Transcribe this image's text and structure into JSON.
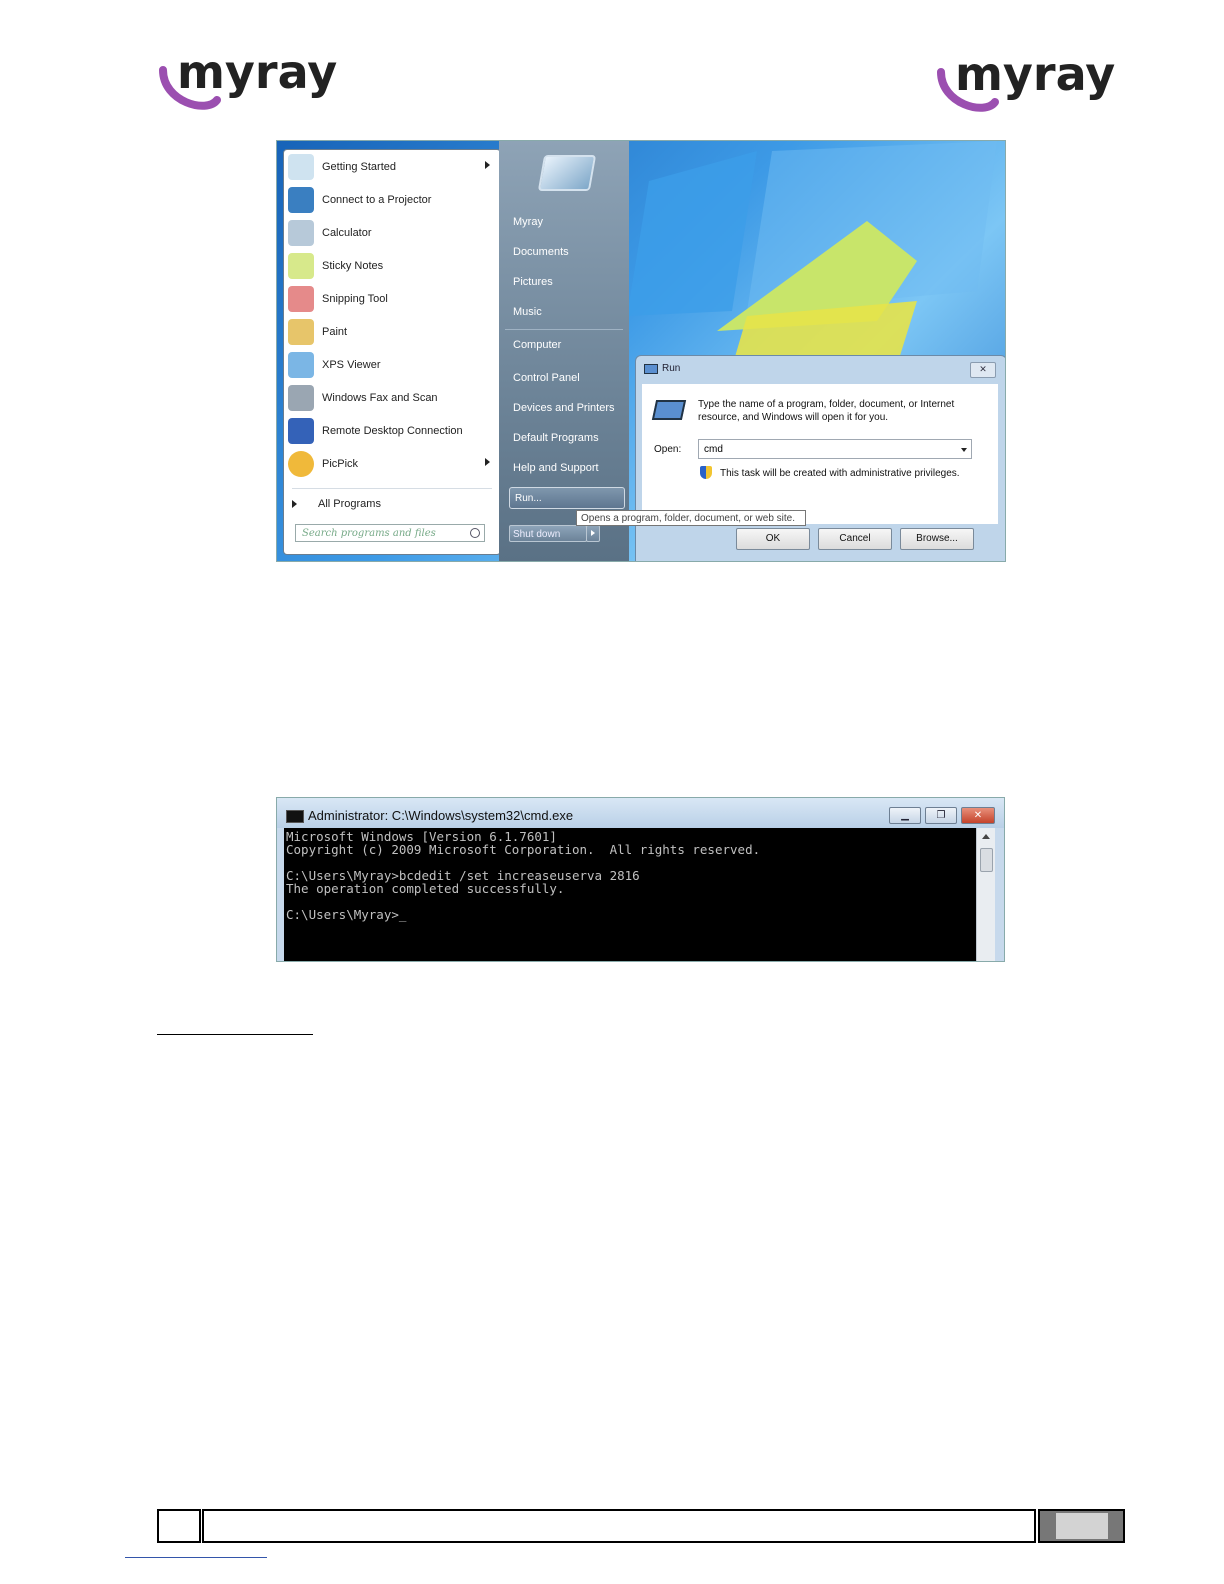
{
  "brand": {
    "logo_text": "myray",
    "accent": "#9b4fb0",
    "ink": "#222222"
  },
  "start_menu": {
    "programs": [
      {
        "label": "Getting Started",
        "icon": "getting-started-icon",
        "submenu": true
      },
      {
        "label": "Connect to a Projector",
        "icon": "projector-icon",
        "submenu": false
      },
      {
        "label": "Calculator",
        "icon": "calculator-icon",
        "submenu": false
      },
      {
        "label": "Sticky Notes",
        "icon": "sticky-notes-icon",
        "submenu": false
      },
      {
        "label": "Snipping Tool",
        "icon": "snipping-tool-icon",
        "submenu": false
      },
      {
        "label": "Paint",
        "icon": "paint-icon",
        "submenu": false
      },
      {
        "label": "XPS Viewer",
        "icon": "xps-viewer-icon",
        "submenu": false
      },
      {
        "label": "Windows Fax and Scan",
        "icon": "fax-scan-icon",
        "submenu": false
      },
      {
        "label": "Remote Desktop Connection",
        "icon": "remote-desktop-icon",
        "submenu": false
      },
      {
        "label": "PicPick",
        "icon": "picpick-icon",
        "submenu": true
      }
    ],
    "all_programs": "All Programs",
    "search_placeholder": "Search programs and files",
    "right_items": [
      "Myray",
      "Documents",
      "Pictures",
      "Music",
      "Computer",
      "Control Panel",
      "Devices and Printers",
      "Default Programs",
      "Help and Support"
    ],
    "run_label": "Run...",
    "shutdown_label": "Shut down",
    "tooltip": "Opens a program, folder, document, or web site."
  },
  "run_dialog": {
    "title": "Run",
    "description": "Type the name of a program, folder, document, or Internet resource, and Windows will open it for you.",
    "open_label": "Open:",
    "open_value": "cmd",
    "admin_note": "This task will be created with administrative privileges.",
    "buttons": {
      "ok": "OK",
      "cancel": "Cancel",
      "browse": "Browse..."
    }
  },
  "cmd_window": {
    "title": "Administrator: C:\\Windows\\system32\\cmd.exe",
    "lines": [
      "Microsoft Windows [Version 6.1.7601]",
      "Copyright (c) 2009 Microsoft Corporation.  All rights reserved.",
      "",
      "C:\\Users\\Myray>bcdedit /set increaseuserva 2816",
      "The operation completed successfully.",
      "",
      "C:\\Users\\Myray>_"
    ]
  }
}
